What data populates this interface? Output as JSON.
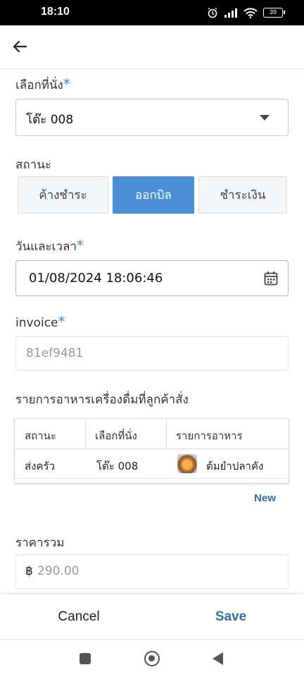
{
  "status_bar": {
    "time": "18:10",
    "battery": "39",
    "icons": [
      "alarm-icon",
      "signal-icon",
      "wifi-icon",
      "battery-icon"
    ]
  },
  "appbar": {
    "back_icon": "arrow-left-icon"
  },
  "form": {
    "seat_label": "เลือกที่นั่ง",
    "seat_required": "*",
    "seat_value": "โต๊ะ 008",
    "status_label": "สถานะ",
    "status_options": [
      "ค้างชำระ",
      "ออกบิล",
      "ชำระเงิน"
    ],
    "status_selected": "ออกบิล",
    "datetime_label": "วันและเวลา",
    "datetime_required": "*",
    "datetime_value": "01/08/2024 18:06:46",
    "invoice_label": "invoice",
    "invoice_required": "*",
    "invoice_value": "81ef9481",
    "orders_label": "รายการอาหารเครื่องดื่มที่ลูกค้าสั่ง",
    "orders_table": {
      "headers": [
        "สถานะ",
        "เลือกที่นั่ง",
        "รายการอาหาร"
      ],
      "rows": [
        {
          "status": "ส่งครัว",
          "seat": "โต๊ะ 008",
          "item": "ต้มยำปลาคัง"
        }
      ]
    },
    "new_label": "New",
    "total_label": "ราคารวม",
    "total_currency": "฿",
    "total_value": "290.00"
  },
  "footer": {
    "cancel_label": "Cancel",
    "save_label": "Save"
  },
  "colors": {
    "accent": "#4a90d9",
    "link": "#2d6fb5",
    "required": "#3b8ad8"
  }
}
